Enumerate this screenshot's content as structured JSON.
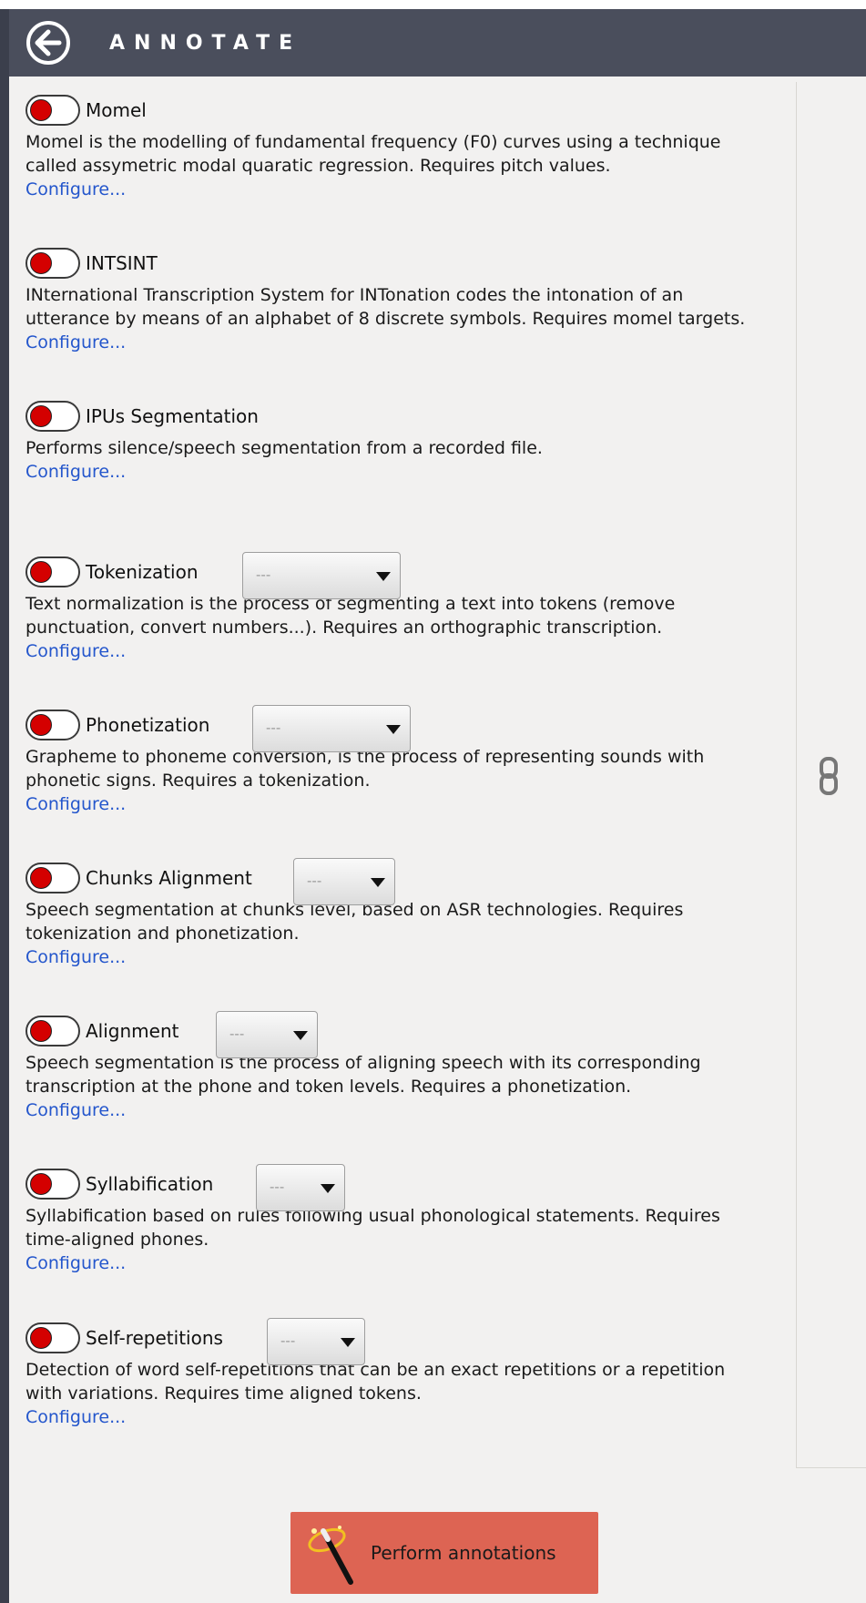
{
  "header": {
    "title": "ANNOTATE",
    "back_icon": "back-arrow-icon"
  },
  "annotations": [
    {
      "name": "Momel",
      "description": "Momel is the modelling of fundamental frequency (F0) curves using a technique called assymetric modal quaratic regression. Requires pitch values.",
      "configure": "Configure...",
      "dropdown": null,
      "enabled": false
    },
    {
      "name": "INTSINT",
      "description": "INternational Transcription System for INTonation codes the intonation of an utterance by means of an alphabet of 8 discrete symbols. Requires momel targets.",
      "configure": "Configure...",
      "dropdown": null,
      "enabled": false
    },
    {
      "name": "IPUs Segmentation",
      "description": "Performs silence/speech segmentation from a recorded file.",
      "configure": "Configure...",
      "dropdown": null,
      "enabled": false
    },
    {
      "name": "Tokenization",
      "description": "Text normalization is the process of segmenting a text into tokens (remove punctuation, convert numbers...). Requires an orthographic transcription.",
      "configure": "Configure...",
      "dropdown": "---",
      "enabled": false
    },
    {
      "name": "Phonetization",
      "description": "Grapheme to phoneme conversion, is the process of representing sounds with phonetic signs. Requires a tokenization.",
      "configure": "Configure...",
      "dropdown": "---",
      "enabled": false
    },
    {
      "name": "Chunks Alignment",
      "description": "Speech segmentation at chunks level, based on ASR technologies. Requires tokenization and phonetization.",
      "configure": "Configure...",
      "dropdown": "---",
      "enabled": false
    },
    {
      "name": "Alignment",
      "description": "Speech segmentation is the process of aligning speech with its corresponding transcription at the phone and token levels. Requires a phonetization.",
      "configure": "Configure...",
      "dropdown": "---",
      "enabled": false
    },
    {
      "name": "Syllabification",
      "description": "Syllabification based on rules following usual phonological statements. Requires time-aligned phones.",
      "configure": "Configure...",
      "dropdown": "---",
      "enabled": false
    },
    {
      "name": "Self-repetitions",
      "description": "Detection of word self-repetitions that can be an exact repetitions or a repetition with variations. Requires time aligned tokens.",
      "configure": "Configure...",
      "dropdown": "---",
      "enabled": false
    }
  ],
  "perform_button": {
    "label": "Perform annotations",
    "icon": "magic-wand-icon"
  },
  "side_panel": {
    "icon": "link-icon"
  },
  "colors": {
    "header_bg": "#4a4e5c",
    "toggle_off": "#d40000",
    "link": "#2456cc",
    "perform_bg": "#dd6453"
  }
}
